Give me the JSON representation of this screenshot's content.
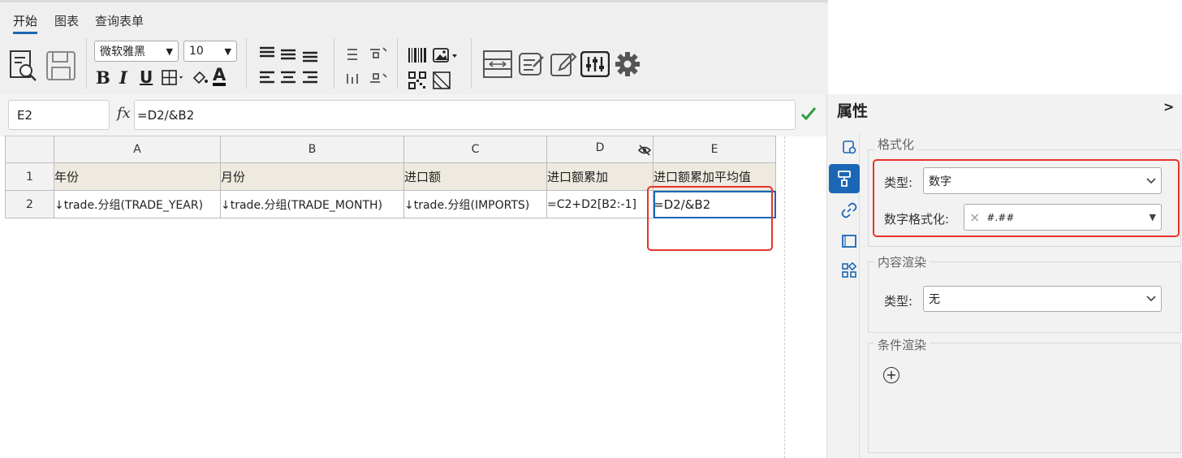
{
  "ribbon": {
    "tabs": [
      "开始",
      "图表",
      "查询表单"
    ],
    "font_family": "微软雅黑",
    "font_size": "10",
    "format_buttons": {
      "bold": "B",
      "italic": "I",
      "underline": "U",
      "font_color": "A"
    }
  },
  "formula": {
    "cell_ref": "E2",
    "fx": "fx",
    "value": "=D2/&B2"
  },
  "grid": {
    "columns": [
      "A",
      "B",
      "C",
      "D",
      "E"
    ],
    "rows": [
      "1",
      "2"
    ],
    "row1": [
      "年份",
      "月份",
      "进口额",
      "进口额累加",
      "进口额累加平均值"
    ],
    "row2": [
      "↓trade.分组(TRADE_YEAR)",
      "↓trade.分组(TRADE_MONTH)",
      "↓trade.分组(IMPORTS)",
      "=C2+D2[B2:-1]",
      "=D2/&B2"
    ]
  },
  "panel": {
    "title": "属性",
    "collapse": ">",
    "format_section": {
      "legend": "格式化",
      "type_label": "类型:",
      "type_value": "数字",
      "number_format_label": "数字格式化:",
      "number_format_value": "#.##",
      "clear": "×"
    },
    "render_section": {
      "legend": "内容渲染",
      "type_label": "类型:",
      "type_value": "无"
    },
    "condition_section": {
      "legend": "条件渲染",
      "add": "+"
    }
  },
  "colors": {
    "accent": "#1b67b5",
    "highlight": "#e8322b",
    "check": "#2e9e3f"
  }
}
